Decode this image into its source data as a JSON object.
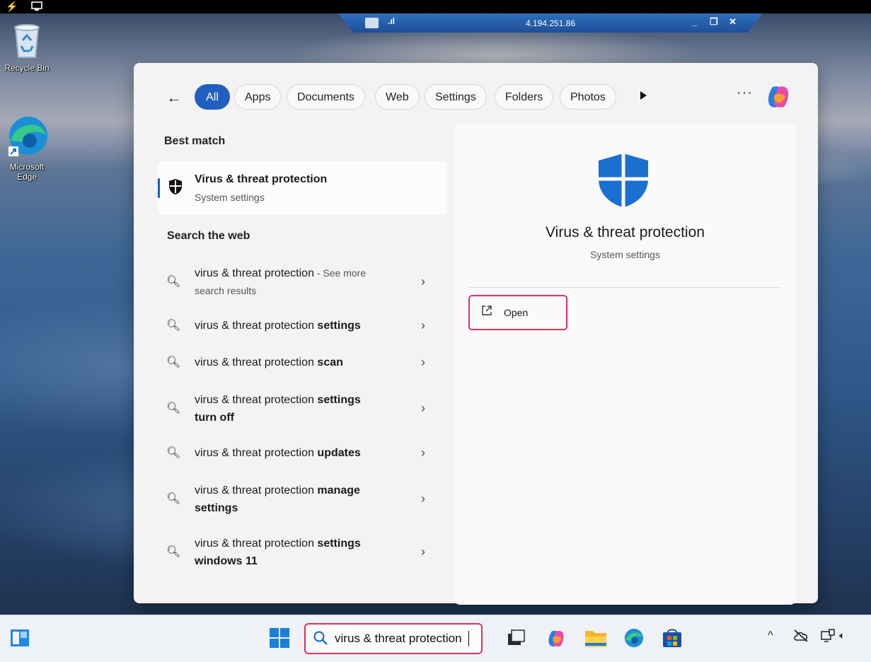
{
  "remote": {
    "ip": "4.194.251.86"
  },
  "desktop": {
    "icons": [
      {
        "label": "Recycle Bin"
      },
      {
        "label": "Microsoft Edge"
      }
    ]
  },
  "search": {
    "filters": [
      "All",
      "Apps",
      "Documents",
      "Web",
      "Settings",
      "Folders",
      "Photos"
    ],
    "active_filter": "All",
    "best_match_title": "Best match",
    "best_match": {
      "name": "Virus & threat protection",
      "subtitle": "System settings"
    },
    "web_title": "Search the web",
    "web_results": [
      {
        "prefix": "virus & threat protection",
        "bold": "",
        "extra": " - See more search results"
      },
      {
        "prefix": "virus & threat protection ",
        "bold": "settings",
        "extra": ""
      },
      {
        "prefix": "virus & threat protection ",
        "bold": "scan",
        "extra": ""
      },
      {
        "prefix": "virus & threat protection ",
        "bold": "settings turn off",
        "extra": ""
      },
      {
        "prefix": "virus & threat protection ",
        "bold": "updates",
        "extra": ""
      },
      {
        "prefix": "virus & threat protection ",
        "bold": "manage settings",
        "extra": ""
      },
      {
        "prefix": "virus & threat protection ",
        "bold": "settings windows 11",
        "extra": ""
      }
    ],
    "detail": {
      "name": "Virus & threat protection",
      "subtitle": "System settings",
      "open_label": "Open"
    },
    "query": "virus & threat protection"
  },
  "icons": {
    "back": "arrow-left-icon",
    "more": "more-icon",
    "copilot": "copilot-icon",
    "shield": "shield-icon",
    "search": "search-icon",
    "chevron": "chevron-right-icon",
    "open": "external-link-icon"
  }
}
